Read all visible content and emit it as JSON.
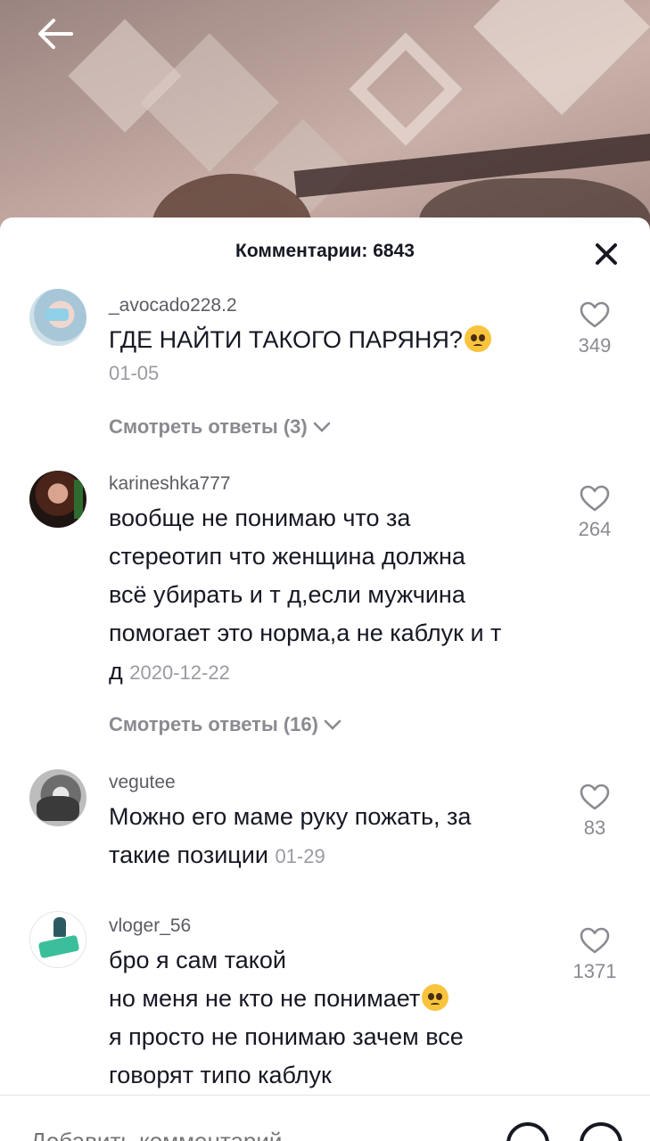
{
  "header": {
    "title": "Комментарии: 6843"
  },
  "comments": [
    {
      "username": "_avocado228.2",
      "text": "ГДЕ НАЙТИ ТАКОГО ПАРЯНЯ?",
      "date": "01-05",
      "likes": "349",
      "replies": "Смотреть ответы (3)",
      "emoji": "pleading-face"
    },
    {
      "username": "karineshka777",
      "lines": [
        "вообще не понимаю что за",
        "стереотип что женщина должна",
        "всё убирать и т д,если мужчина",
        "помогает это норма,а не каблук и т",
        "д"
      ],
      "date": "2020-12-22",
      "likes": "264",
      "replies": "Смотреть ответы (16)"
    },
    {
      "username": "vegutee",
      "lines": [
        "Можно его маме руку пожать, за",
        "такие позиции"
      ],
      "date": "01-29",
      "likes": "83"
    },
    {
      "username": "vloger_56",
      "lines": [
        "бро я сам такой",
        "но меня не кто не понимает",
        "я просто не понимаю зачем все",
        "говорят типо каблук"
      ],
      "likes": "1371",
      "emoji": "pleading-face"
    }
  ],
  "input": {
    "placeholder": "Добавить комментарий"
  },
  "icons": [
    "back-arrow-icon",
    "close-icon",
    "heart-icon",
    "chevron-down-icon",
    "at-icon",
    "emoji-icon"
  ],
  "colors": {
    "text": "#161823",
    "secondary": "#8a8b91",
    "date": "#9a9ba1"
  }
}
